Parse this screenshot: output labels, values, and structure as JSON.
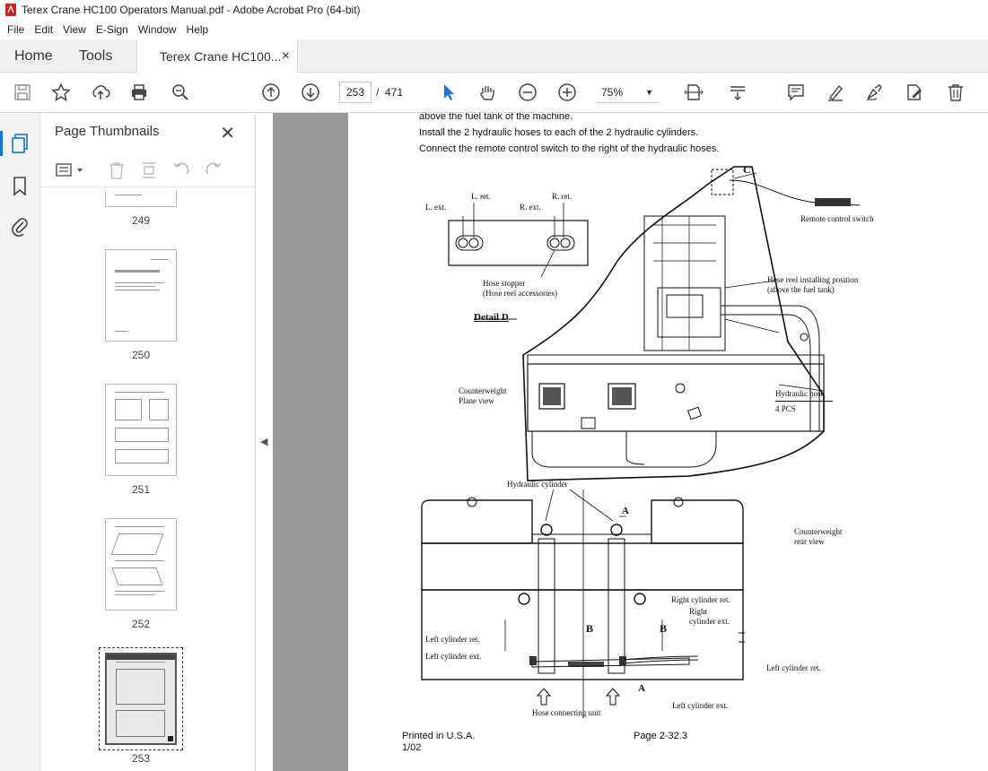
{
  "window": {
    "title": "Terex Crane HC100 Operators Manual.pdf - Adobe Acrobat Pro (64-bit)"
  },
  "menu": [
    "File",
    "Edit",
    "View",
    "E-Sign",
    "Window",
    "Help"
  ],
  "tabs": {
    "home": "Home",
    "tools": "Tools",
    "document": "Terex Crane HC100...",
    "close": "×"
  },
  "toolbar": {
    "current_page": "253",
    "page_sep": "/",
    "total_pages": "471",
    "zoom": "75%",
    "icons": [
      "save-icon",
      "star-icon",
      "upload-icon",
      "print-icon",
      "zoom-search-icon",
      "page-up-icon",
      "page-down-icon",
      "select-cursor-icon",
      "hand-icon",
      "zoom-out-icon",
      "zoom-in-icon",
      "fit-page-icon",
      "scroll-mode-icon",
      "comment-icon",
      "highlight-icon",
      "sign-icon",
      "edit-pdf-icon",
      "delete-icon"
    ]
  },
  "sidebar": {
    "title": "Page Thumbnails",
    "close": "✕",
    "thumbnails": [
      {
        "label": "249"
      },
      {
        "label": "250"
      },
      {
        "label": "251"
      },
      {
        "label": "252"
      },
      {
        "label": "253",
        "selected": true
      }
    ]
  },
  "page": {
    "lines": [
      "above the fuel tank of the machine.",
      "Install the 2 hydraulic hoses to each of the 2 hydraulic cylinders.",
      "Connect the remote control switch to the right of the hydraulic hoses."
    ],
    "diagram_labels": {
      "c": "C",
      "l_ret": "L. ret.",
      "r_ret": "R. ret.",
      "l_ext": "L. ext.",
      "r_ext": "R. ext.",
      "remote": "Remote control switch",
      "hose_stopper": "Hose stopper",
      "hose_stopper2": "(Hose reel accessories)",
      "detail_d": "Detail D",
      "reel_pos": "Hose reel installing position",
      "reel_pos2": "(above the fuel tank)",
      "cw_plane": "Counterweight",
      "cw_plane2": "Plane view",
      "hyd_hose": "Hydraulic hose",
      "pcs": "4 PCS",
      "hyd_cyl": "Hydraulic cylinder",
      "a_top": "A",
      "cw_rear": "Counterweight",
      "cw_rear2": "rear view",
      "right_cyl_ret": "Right cylinder ret.",
      "right": "Right",
      "cyl_ext": "cylinder ext.",
      "b_left": "B",
      "b_right": "B",
      "left_cyl_ret": "Left cylinder ret.",
      "left_cyl_ext": "Left cylinder ext.",
      "left_cyl_ret2": "Left cylinder ret.",
      "a_bottom": "A",
      "left_cyl_ext2": "Left cylinder ext.",
      "hose_unit": "Hose connecting unit"
    },
    "footer_left": "Printed in U.S.A.",
    "footer_left2": "1/02",
    "footer_right": "Page 2-32.3"
  }
}
